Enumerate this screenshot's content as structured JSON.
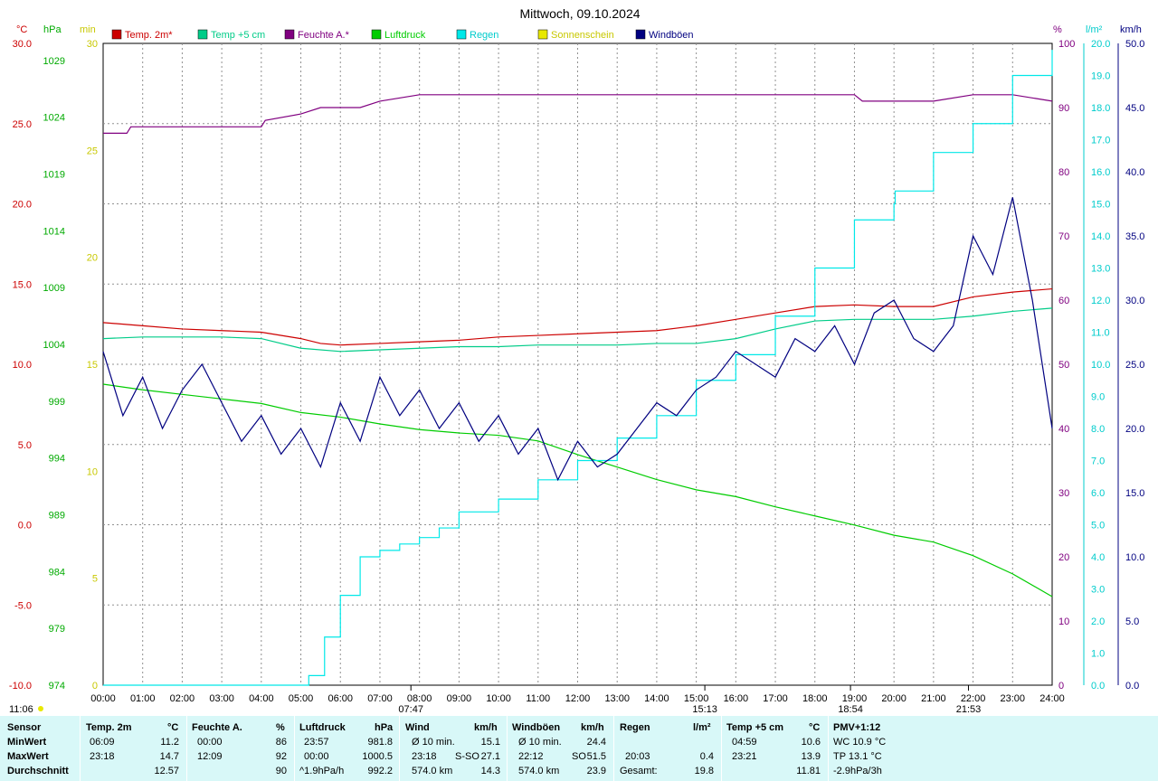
{
  "title": "Mittwoch, 09.10.2024",
  "units": {
    "temp": "°C",
    "hpa": "hPa",
    "min": "min",
    "pct": "%",
    "rain": "l/m²",
    "wind": "km/h"
  },
  "legend": [
    {
      "label": "Temp. 2m*",
      "color": "#cc0000"
    },
    {
      "label": "Temp +5 cm",
      "color": "#00cc88"
    },
    {
      "label": "Feuchte A.*",
      "color": "#800080"
    },
    {
      "label": "Luftdruck",
      "color": "#00cc00"
    },
    {
      "label": "Regen",
      "color": "#00e8e8"
    },
    {
      "label": "Sonnenschein",
      "color": "#e8e800"
    },
    {
      "label": "Windböen",
      "color": "#000080"
    }
  ],
  "axis_ticks": {
    "temp": [
      "30.0",
      "25.0",
      "20.0",
      "15.0",
      "10.0",
      "5.0",
      "0.0",
      "-5.0",
      "-10.0"
    ],
    "hpa": [
      "1029",
      "1024",
      "1019",
      "1014",
      "1009",
      "1004",
      "999",
      "994",
      "989",
      "984",
      "979",
      "974"
    ],
    "min": [
      "30",
      "25",
      "20",
      "15",
      "10",
      "5",
      "0"
    ],
    "pct": [
      "100",
      "90",
      "80",
      "70",
      "60",
      "50",
      "40",
      "30",
      "20",
      "10",
      "0"
    ],
    "rain": [
      "20.0",
      "19.0",
      "18.0",
      "17.0",
      "16.0",
      "15.0",
      "14.0",
      "13.0",
      "12.0",
      "11.0",
      "10.0",
      "9.0",
      "8.0",
      "7.0",
      "6.0",
      "5.0",
      "4.0",
      "3.0",
      "2.0",
      "1.0",
      "0.0"
    ],
    "wind": [
      "50.0",
      "45.0",
      "40.0",
      "35.0",
      "30.0",
      "25.0",
      "20.0",
      "15.0",
      "10.0",
      "5.0",
      "0.0"
    ],
    "time": [
      "00:00",
      "01:00",
      "02:00",
      "03:00",
      "04:00",
      "05:00",
      "06:00",
      "07:00",
      "08:00",
      "09:00",
      "10:00",
      "11:00",
      "12:00",
      "13:00",
      "14:00",
      "15:00",
      "16:00",
      "17:00",
      "18:00",
      "19:00",
      "20:00",
      "21:00",
      "22:00",
      "23:00",
      "24:00"
    ]
  },
  "markers": {
    "sunrise": "07:47",
    "sunset": "18:54",
    "moon_rise": "15:13",
    "moon_set": "21:53",
    "daylength": "11:06"
  },
  "chart_data": {
    "type": "line",
    "title": "Mittwoch, 09.10.2024",
    "x_range": [
      "00:00",
      "24:00"
    ],
    "series": [
      {
        "name": "Temp. 2m*",
        "axis": "°C",
        "color": "#cc0000",
        "x": [
          0,
          1,
          2,
          3,
          4,
          5,
          5.5,
          6,
          7,
          8,
          9,
          10,
          11,
          12,
          13,
          14,
          15,
          16,
          17,
          18,
          19,
          20,
          21,
          22,
          23,
          24
        ],
        "y": [
          12.6,
          12.4,
          12.2,
          12.1,
          12.0,
          11.6,
          11.3,
          11.2,
          11.3,
          11.4,
          11.5,
          11.7,
          11.8,
          11.9,
          12.0,
          12.1,
          12.4,
          12.8,
          13.2,
          13.6,
          13.7,
          13.6,
          13.6,
          14.2,
          14.5,
          14.7
        ]
      },
      {
        "name": "Temp +5 cm",
        "axis": "°C",
        "color": "#00cc88",
        "x": [
          0,
          1,
          2,
          3,
          4,
          5,
          6,
          7,
          8,
          9,
          10,
          11,
          12,
          13,
          14,
          15,
          16,
          17,
          18,
          19,
          20,
          21,
          22,
          23,
          24
        ],
        "y": [
          11.6,
          11.7,
          11.7,
          11.7,
          11.6,
          11.0,
          10.8,
          10.9,
          11.0,
          11.1,
          11.1,
          11.2,
          11.2,
          11.2,
          11.3,
          11.3,
          11.6,
          12.2,
          12.7,
          12.8,
          12.8,
          12.8,
          13.0,
          13.3,
          13.5
        ]
      },
      {
        "name": "Feuchte A.*",
        "axis": "%",
        "color": "#800080",
        "x": [
          0,
          0.6,
          0.7,
          4,
          4.1,
          5,
          5.5,
          6.5,
          7,
          8,
          9,
          10,
          12,
          13,
          14,
          15,
          17,
          18,
          19,
          19.2,
          20,
          21,
          22,
          23,
          24
        ],
        "y": [
          86,
          86,
          87,
          87,
          88,
          89,
          90,
          90,
          91,
          92,
          92,
          92,
          92,
          92,
          92,
          92,
          92,
          92,
          92,
          91,
          91,
          91,
          92,
          92,
          91
        ]
      },
      {
        "name": "Luftdruck",
        "axis": "hPa",
        "color": "#00cc00",
        "x": [
          0,
          1,
          2,
          3,
          4,
          5,
          6,
          7,
          8,
          9,
          10,
          11,
          12,
          13,
          14,
          15,
          16,
          17,
          18,
          19,
          20,
          21,
          22,
          23,
          24
        ],
        "y": [
          1000.5,
          1000.0,
          999.6,
          999.2,
          998.8,
          998.0,
          997.6,
          997.0,
          996.5,
          996.2,
          996.0,
          995.5,
          994.3,
          993.2,
          992.1,
          991.2,
          990.6,
          989.7,
          988.9,
          988.1,
          987.2,
          986.6,
          985.4,
          983.8,
          981.8
        ]
      },
      {
        "name": "Regen",
        "axis": "l/m²",
        "color": "#00e8e8",
        "x": [
          0,
          5,
          5.2,
          5.6,
          6,
          6.5,
          7,
          7.5,
          8,
          8.5,
          9,
          10,
          11,
          12,
          13,
          14,
          15,
          16,
          17,
          18,
          19,
          20,
          20.03,
          21,
          22,
          23,
          24
        ],
        "y": [
          0,
          0,
          0.3,
          1.5,
          2.8,
          4.0,
          4.2,
          4.4,
          4.6,
          4.9,
          5.4,
          5.8,
          6.4,
          7.0,
          7.7,
          8.4,
          9.5,
          10.3,
          11.5,
          13.0,
          14.5,
          15.0,
          15.4,
          16.6,
          17.5,
          19.0,
          19.8
        ]
      },
      {
        "name": "Windböen",
        "axis": "km/h",
        "color": "#000080",
        "x": [
          0,
          0.5,
          1,
          1.5,
          2,
          2.5,
          3,
          3.5,
          4,
          4.5,
          5,
          5.5,
          6,
          6.5,
          7,
          7.5,
          8,
          8.5,
          9,
          9.5,
          10,
          10.5,
          11,
          11.5,
          12,
          12.5,
          13,
          13.5,
          14,
          14.5,
          15,
          15.5,
          16,
          16.5,
          17,
          17.5,
          18,
          18.5,
          19,
          19.5,
          20,
          20.5,
          21,
          21.5,
          22,
          22.5,
          23,
          23.5,
          24
        ],
        "y": [
          26,
          21,
          24,
          20,
          23,
          25,
          22,
          19,
          21,
          18,
          20,
          17,
          22,
          19,
          24,
          21,
          23,
          20,
          22,
          19,
          21,
          18,
          20,
          16,
          19,
          17,
          18,
          20,
          22,
          21,
          23,
          24,
          26,
          25,
          24,
          27,
          26,
          28,
          25,
          29,
          30,
          27,
          26,
          28,
          35,
          32,
          38,
          30,
          20
        ]
      }
    ],
    "wind_max": {
      "value": 51.5,
      "time": "22:12"
    }
  },
  "stats": {
    "headers": {
      "sensor": "Sensor",
      "temp2m": "Temp. 2m",
      "temp2m_unit": "°C",
      "hum": "Feuchte A.",
      "hum_unit": "%",
      "press": "Luftdruck",
      "press_unit": "hPa",
      "wind": "Wind",
      "wind_unit": "km/h",
      "gust": "Windböen",
      "gust_unit": "km/h",
      "rain": "Regen",
      "rain_unit": "l/m²",
      "t5": "Temp +5 cm",
      "t5_unit": "°C",
      "pmv": "PMV+1:12"
    },
    "rows": {
      "min": "MinWert",
      "max": "MaxWert",
      "avg": "Durchschnitt"
    },
    "temp2m": {
      "min_t": "06:09",
      "min_v": "11.2",
      "max_t": "23:18",
      "max_v": "14.7",
      "avg": "12.57"
    },
    "hum": {
      "min_t": "00:00",
      "min_v": "86",
      "max_t": "12:09",
      "max_v": "92",
      "avg": "90"
    },
    "press": {
      "min_t": "23:57",
      "min_v": "981.8",
      "max_t": "00:00",
      "max_v": "1000.5",
      "trend": "^1.9hPa/h",
      "avg": "992.2"
    },
    "wind": {
      "avg10_label": "Ø 10 min.",
      "avg10": "15.1",
      "max_t": "23:18",
      "max_dir": "S-SO",
      "max_v": "27.1",
      "dist": "574.0 km",
      "avg": "14.3"
    },
    "gust": {
      "avg10_label": "Ø 10 min.",
      "avg10": "24.4",
      "max_t": "22:12",
      "max_dir": "SO",
      "max_v": "51.5",
      "dist": "574.0 km",
      "avg": "23.9"
    },
    "rain": {
      "max_t": "20:03",
      "max_v": "0.4",
      "total_label": "Gesamt:",
      "total": "19.8"
    },
    "t5": {
      "min_t": "04:59",
      "min_v": "10.6",
      "max_t": "23:21",
      "max_v": "13.9",
      "avg": "11.81"
    },
    "pmv": {
      "wc": "WC 10.9 °C",
      "tp": "TP 13.1 °C",
      "trend": "-2.9hPa/3h"
    }
  }
}
